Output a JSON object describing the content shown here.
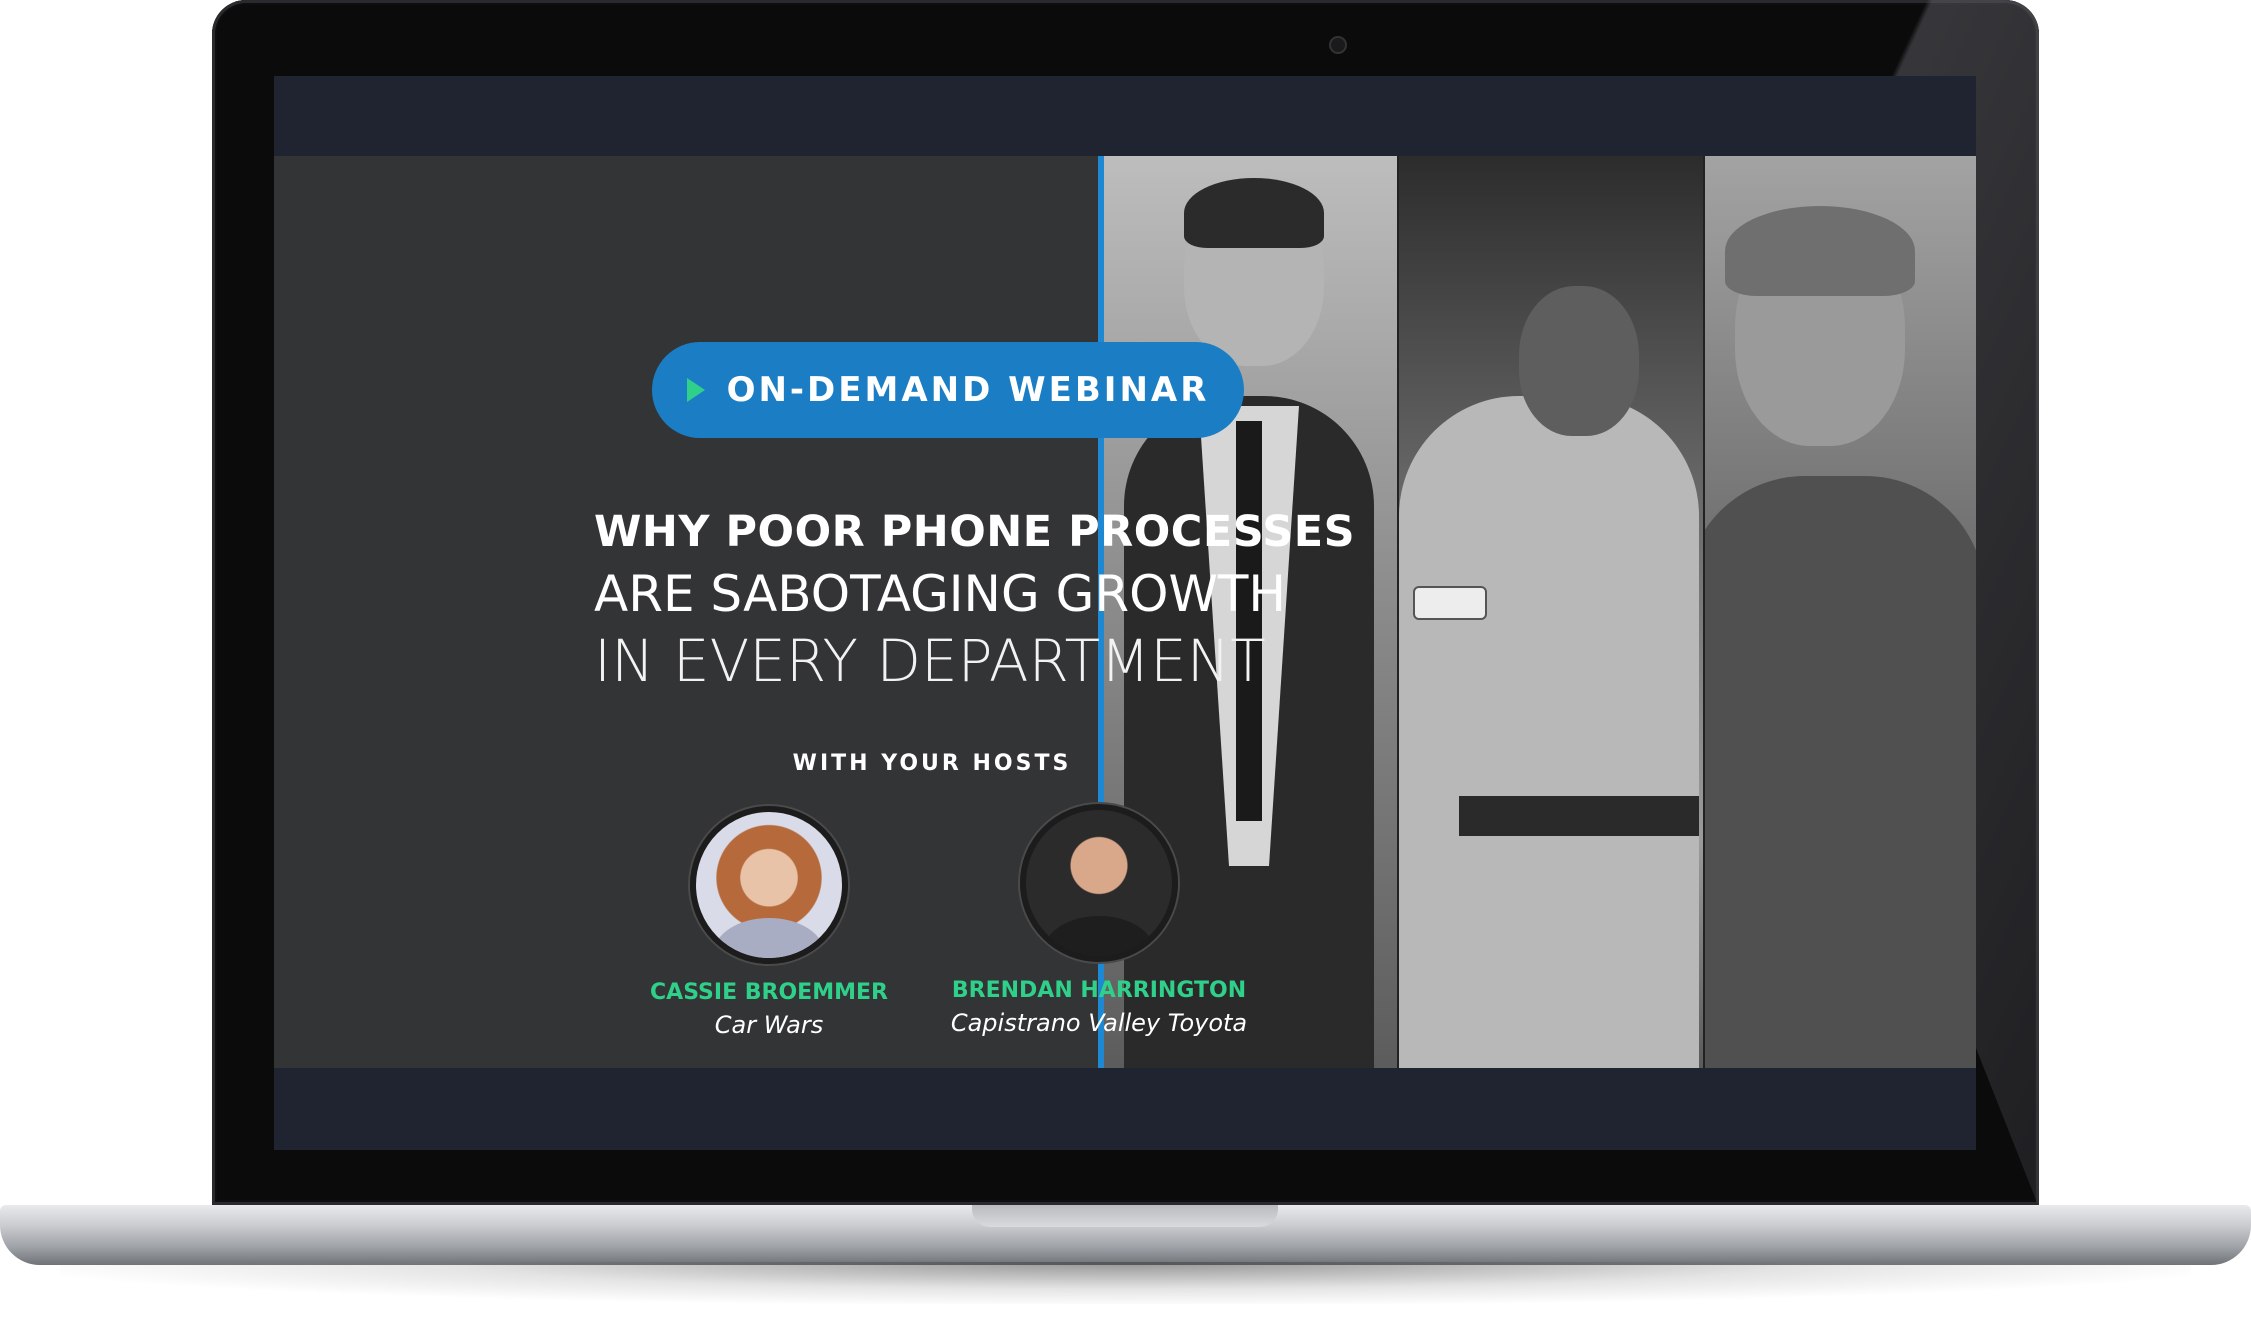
{
  "webinar": {
    "badge_label": "ON-DEMAND WEBINAR",
    "headline": {
      "line1": "WHY POOR PHONE PROCESSES",
      "line2": "ARE SABOTAGING GROWTH",
      "line3": "IN EVERY DEPARTMENT"
    },
    "hosts_title": "WITH YOUR HOSTS",
    "hosts": [
      {
        "name": "CASSIE BROEMMER",
        "org": "Car Wars"
      },
      {
        "name": "BRENDAN HARRINGTON",
        "org": "Capistrano Valley Toyota"
      }
    ]
  },
  "colors": {
    "badge_bg": "#1b7ec4",
    "accent_green": "#2fd08a",
    "panel_bg": "#333436",
    "divider_blue": "#1e88d2",
    "bar_bg": "#1f2430"
  },
  "icons": {
    "badge_icon": "play-icon"
  }
}
